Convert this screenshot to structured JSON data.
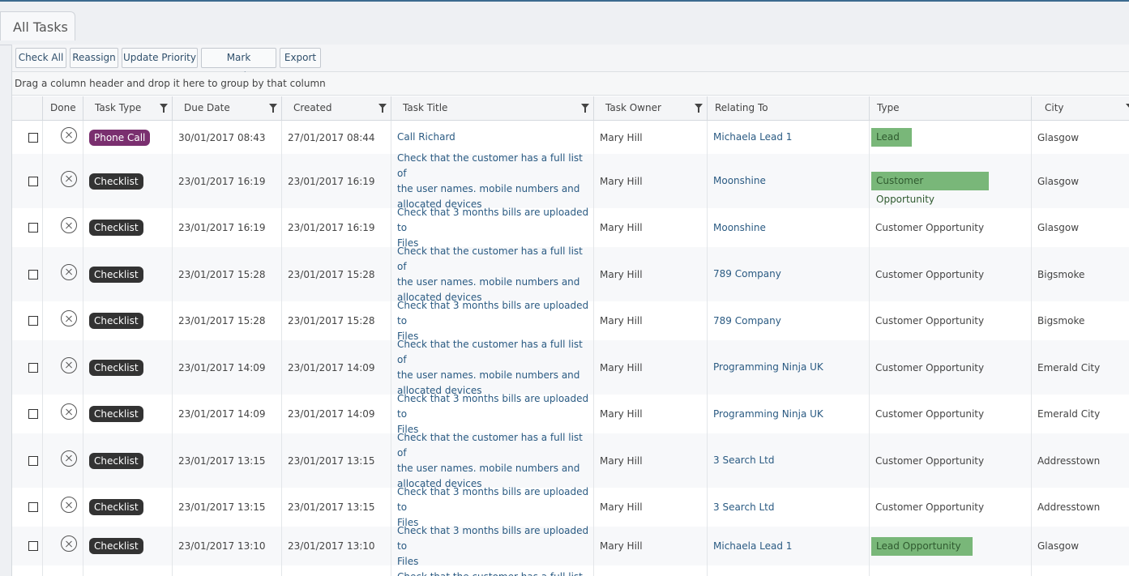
{
  "page": {
    "tab_label": "All Tasks",
    "toolbar": [
      "Check All",
      "Reassign",
      "Update Priority",
      "Mark Complete",
      "Export"
    ],
    "group_hint": "Drag a column header and drop it here to group by that column"
  },
  "grid": {
    "columns": [
      "Done",
      "Task Type",
      "Due Date",
      "Created",
      "Task Title",
      "Task Owner",
      "Relating To",
      "Type",
      "City"
    ],
    "colors": {
      "phone_call": "#7a2f6f",
      "checklist": "#333333",
      "type_highlight": "#79b779",
      "link": "#2a5a82"
    },
    "rows": [
      {
        "task_type": "Phone Call",
        "due": "30/01/2017 08:43",
        "created": "27/01/2017 08:44",
        "title_lines": [
          "Call Richard"
        ],
        "owner": "Mary Hill",
        "relating": "Michaela Lead 1",
        "type": "Lead",
        "type_highlight": true,
        "city": "Glasgow"
      },
      {
        "task_type": "Checklist",
        "due": "23/01/2017 16:19",
        "created": "23/01/2017 16:19",
        "title_lines": [
          "Check that the customer has a full list of",
          "the user names. mobile numbers and",
          "allocated devices"
        ],
        "owner": "Mary Hill",
        "relating": "Moonshine",
        "type": "Customer Opportunity",
        "type_highlight": true,
        "city": "Glasgow"
      },
      {
        "task_type": "Checklist",
        "due": "23/01/2017 16:19",
        "created": "23/01/2017 16:19",
        "title_lines": [
          "Check that 3 months bills are uploaded to",
          "Files"
        ],
        "owner": "Mary Hill",
        "relating": "Moonshine",
        "type": "Customer Opportunity",
        "type_highlight": false,
        "city": "Glasgow"
      },
      {
        "task_type": "Checklist",
        "due": "23/01/2017 15:28",
        "created": "23/01/2017 15:28",
        "title_lines": [
          "Check that the customer has a full list of",
          "the user names. mobile numbers and",
          "allocated devices"
        ],
        "owner": "Mary Hill",
        "relating": "789 Company",
        "type": "Customer Opportunity",
        "type_highlight": false,
        "city": "Bigsmoke"
      },
      {
        "task_type": "Checklist",
        "due": "23/01/2017 15:28",
        "created": "23/01/2017 15:28",
        "title_lines": [
          "Check that 3 months bills are uploaded to",
          "Files"
        ],
        "owner": "Mary Hill",
        "relating": "789 Company",
        "type": "Customer Opportunity",
        "type_highlight": false,
        "city": "Bigsmoke"
      },
      {
        "task_type": "Checklist",
        "due": "23/01/2017 14:09",
        "created": "23/01/2017 14:09",
        "title_lines": [
          "Check that the customer has a full list of",
          "the user names. mobile numbers and",
          "allocated devices"
        ],
        "owner": "Mary Hill",
        "relating": "Programming Ninja UK",
        "type": "Customer Opportunity",
        "type_highlight": false,
        "city": "Emerald City"
      },
      {
        "task_type": "Checklist",
        "due": "23/01/2017 14:09",
        "created": "23/01/2017 14:09",
        "title_lines": [
          "Check that 3 months bills are uploaded to",
          "Files"
        ],
        "owner": "Mary Hill",
        "relating": "Programming Ninja UK",
        "type": "Customer Opportunity",
        "type_highlight": false,
        "city": "Emerald City"
      },
      {
        "task_type": "Checklist",
        "due": "23/01/2017 13:15",
        "created": "23/01/2017 13:15",
        "title_lines": [
          "Check that the customer has a full list of",
          "the user names. mobile numbers and",
          "allocated devices"
        ],
        "owner": "Mary Hill",
        "relating": "3 Search Ltd",
        "type": "Customer Opportunity",
        "type_highlight": false,
        "city": "Addresstown"
      },
      {
        "task_type": "Checklist",
        "due": "23/01/2017 13:15",
        "created": "23/01/2017 13:15",
        "title_lines": [
          "Check that 3 months bills are uploaded to",
          "Files"
        ],
        "owner": "Mary Hill",
        "relating": "3 Search Ltd",
        "type": "Customer Opportunity",
        "type_highlight": false,
        "city": "Addresstown"
      },
      {
        "task_type": "Checklist",
        "due": "23/01/2017 13:10",
        "created": "23/01/2017 13:10",
        "title_lines": [
          "Check that 3 months bills are uploaded to",
          "Files"
        ],
        "owner": "Mary Hill",
        "relating": "Michaela Lead 1",
        "type": "Lead Opportunity",
        "type_highlight": true,
        "city": "Glasgow"
      },
      {
        "task_type": "",
        "due": "",
        "created": "",
        "title_lines": [
          "Check that the customer has a full list of"
        ],
        "owner": "",
        "relating": "",
        "type": "",
        "type_highlight": false,
        "city": ""
      }
    ]
  }
}
